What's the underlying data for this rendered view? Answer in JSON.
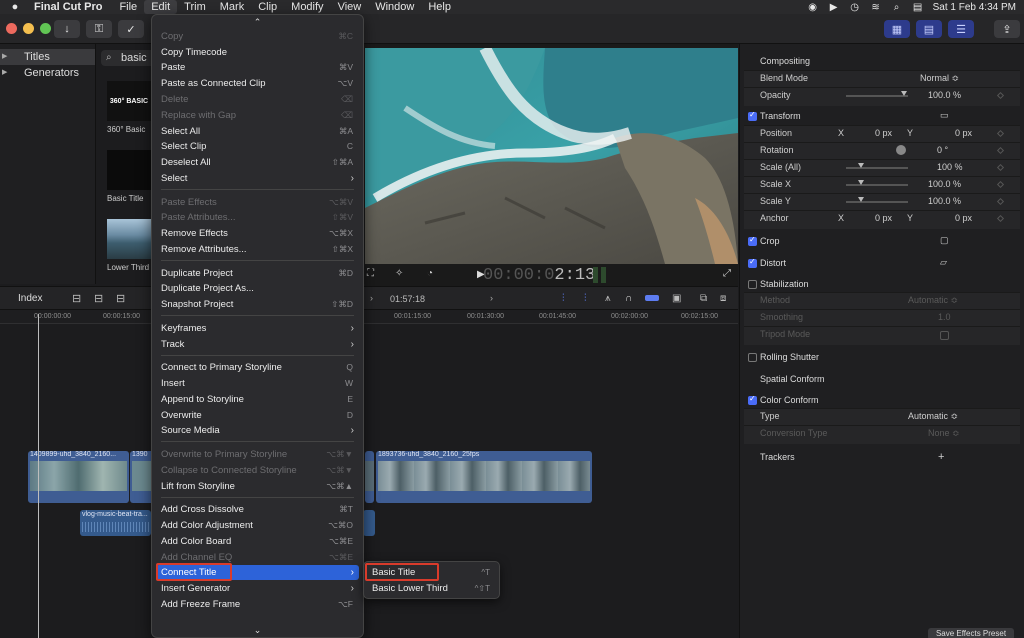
{
  "menubar": {
    "app_name": "Final Cut Pro",
    "menus": [
      "File",
      "Edit",
      "Trim",
      "Mark",
      "Clip",
      "Modify",
      "View",
      "Window",
      "Help"
    ],
    "active_menu": "Edit",
    "date_time": "Sat 1 Feb  4:34 PM"
  },
  "library": {
    "items": [
      {
        "label": "Titles",
        "selected": true
      },
      {
        "label": "Generators",
        "selected": false
      }
    ]
  },
  "browser": {
    "search_value": "basic",
    "thumbnails": [
      {
        "label": "360° Basic",
        "thumb_text": "360° BASIC"
      },
      {
        "label": "Basic Title",
        "thumb_text": ""
      },
      {
        "label": "Lower Third",
        "thumb_text": ""
      }
    ]
  },
  "viewer": {
    "timecode_dim": "00:00:0",
    "timecode_bright": "2:13"
  },
  "timeline": {
    "index_label": "Index",
    "duration": "01:57:18",
    "ruler_ticks": [
      "00:00:00:00",
      "00:00:15:00",
      "00:01:15:00",
      "00:01:30:00",
      "00:01:45:00",
      "00:02:00:00",
      "00:02:15:00"
    ],
    "clips": [
      "1409899-uhd_3840_2160...",
      "1390",
      "1893736-uhd_3840_2160_25fps"
    ],
    "audio_clip": "vlog-music-beat-tra..."
  },
  "edit_menu": {
    "items": [
      {
        "label": "Copy",
        "shortcut": "⌘C",
        "disabled": true
      },
      {
        "label": "Copy Timecode",
        "shortcut": "",
        "disabled": false
      },
      {
        "label": "Paste",
        "shortcut": "⌘V",
        "disabled": false
      },
      {
        "label": "Paste as Connected Clip",
        "shortcut": "⌥V",
        "disabled": false
      },
      {
        "label": "Delete",
        "shortcut": "⌫",
        "disabled": true
      },
      {
        "label": "Replace with Gap",
        "shortcut": "⌫",
        "disabled": true
      },
      {
        "label": "Select All",
        "shortcut": "⌘A",
        "disabled": false
      },
      {
        "label": "Select Clip",
        "shortcut": "C",
        "disabled": false
      },
      {
        "label": "Deselect All",
        "shortcut": "⇧⌘A",
        "disabled": false
      },
      {
        "label": "Select",
        "submenu": true,
        "disabled": false
      },
      {
        "label": "Paste Effects",
        "shortcut": "⌥⌘V",
        "disabled": true
      },
      {
        "label": "Paste Attributes...",
        "shortcut": "⇧⌘V",
        "disabled": true
      },
      {
        "label": "Remove Effects",
        "shortcut": "⌥⌘X",
        "disabled": false
      },
      {
        "label": "Remove Attributes...",
        "shortcut": "⇧⌘X",
        "disabled": false
      },
      {
        "label": "Duplicate Project",
        "shortcut": "⌘D",
        "disabled": false
      },
      {
        "label": "Duplicate Project As...",
        "shortcut": "",
        "disabled": false
      },
      {
        "label": "Snapshot Project",
        "shortcut": "⇧⌘D",
        "disabled": false
      },
      {
        "label": "Keyframes",
        "submenu": true,
        "disabled": false
      },
      {
        "label": "Track",
        "submenu": true,
        "disabled": false
      },
      {
        "label": "Connect to Primary Storyline",
        "shortcut": "Q",
        "disabled": false
      },
      {
        "label": "Insert",
        "shortcut": "W",
        "disabled": false
      },
      {
        "label": "Append to Storyline",
        "shortcut": "E",
        "disabled": false
      },
      {
        "label": "Overwrite",
        "shortcut": "D",
        "disabled": false
      },
      {
        "label": "Source Media",
        "submenu": true,
        "disabled": false
      },
      {
        "label": "Overwrite to Primary Storyline",
        "shortcut": "⌥⌘▼",
        "disabled": true
      },
      {
        "label": "Collapse to Connected Storyline",
        "shortcut": "⌥⌘▼",
        "disabled": true
      },
      {
        "label": "Lift from Storyline",
        "shortcut": "⌥⌘▲",
        "disabled": false
      },
      {
        "label": "Add Cross Dissolve",
        "shortcut": "⌘T",
        "disabled": false
      },
      {
        "label": "Add Color Adjustment",
        "shortcut": "⌥⌘O",
        "disabled": false
      },
      {
        "label": "Add Color Board",
        "shortcut": "⌥⌘E",
        "disabled": false
      },
      {
        "label": "Add Channel EQ",
        "shortcut": "⌥⌘E",
        "disabled": true
      },
      {
        "label": "Connect Title",
        "submenu": true,
        "disabled": false,
        "highlighted": true
      },
      {
        "label": "Insert Generator",
        "submenu": true,
        "disabled": false
      },
      {
        "label": "Add Freeze Frame",
        "shortcut": "⌥F",
        "disabled": false
      }
    ]
  },
  "connect_title_submenu": {
    "items": [
      {
        "label": "Basic Title",
        "shortcut": "^T"
      },
      {
        "label": "Basic Lower Third",
        "shortcut": "^⇧T"
      }
    ]
  },
  "inspector": {
    "compositing": "Compositing",
    "blend_mode_label": "Blend Mode",
    "blend_mode_value": "Normal ≎",
    "opacity_label": "Opacity",
    "opacity_value": "100.0  %",
    "transform": "Transform",
    "position_label": "Position",
    "x_label": "X",
    "position_x": "0  px",
    "y_label": "Y",
    "position_y": "0  px",
    "rotation_label": "Rotation",
    "rotation_value": "0  °",
    "scale_all_label": "Scale (All)",
    "scale_all_value": "100  %",
    "scale_x_label": "Scale X",
    "scale_x_value": "100.0  %",
    "scale_y_label": "Scale Y",
    "scale_y_value": "100.0  %",
    "anchor_label": "Anchor",
    "anchor_x": "0  px",
    "anchor_y": "0  px",
    "crop": "Crop",
    "distort": "Distort",
    "stabilization": "Stabilization",
    "method_label": "Method",
    "method_value": "Automatic ≎",
    "smoothing_label": "Smoothing",
    "smoothing_value": "1.0",
    "tripod_label": "Tripod Mode",
    "rolling_shutter": "Rolling Shutter",
    "spatial_conform": "Spatial Conform",
    "color_conform": "Color Conform",
    "type_label": "Type",
    "type_value": "Automatic ≎",
    "conversion_label": "Conversion Type",
    "conversion_value": "None ≎",
    "trackers": "Trackers",
    "trackers_add": "+",
    "save_preset": "Save Effects Preset"
  },
  "colors": {
    "accent": "#2d63d9",
    "checkbox": "#4a6cf7",
    "callout": "#d93b2b",
    "clip": "#3f5d93"
  }
}
